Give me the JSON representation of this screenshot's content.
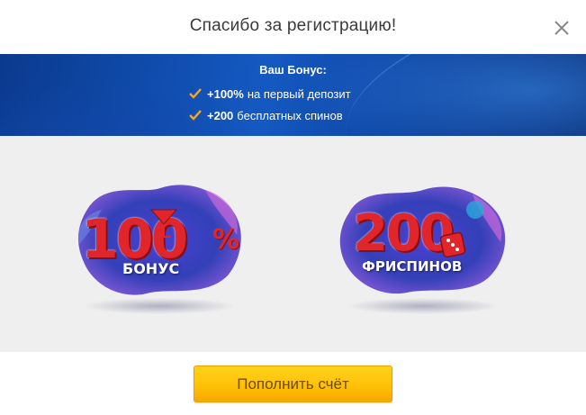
{
  "dialog": {
    "title": "Спасибо за регистрацию!",
    "close_icon": "close-icon"
  },
  "banner": {
    "heading": "Ваш Бонус:",
    "items": [
      {
        "icon": "checkmark-icon",
        "bold": "+100%",
        "text": "на первый депозит"
      },
      {
        "icon": "checkmark-icon",
        "bold": "+200",
        "text": "бесплатных спинов"
      }
    ],
    "colors": {
      "background": "#1459c2",
      "check": "#f5a623"
    }
  },
  "promo": {
    "cards": [
      {
        "number": "100",
        "suffix": "%",
        "label": "БОНУС",
        "icon": "martini-glass-icon"
      },
      {
        "number": "200",
        "suffix": "",
        "label": "ФРИСПИНОВ",
        "icon": "dice-icon"
      }
    ],
    "colors": {
      "number": "#e0262b",
      "cloud": "#3a3fc0"
    }
  },
  "footer": {
    "deposit_button_label": "Пополнить счёт",
    "colors": {
      "button": "#ffc107"
    }
  }
}
